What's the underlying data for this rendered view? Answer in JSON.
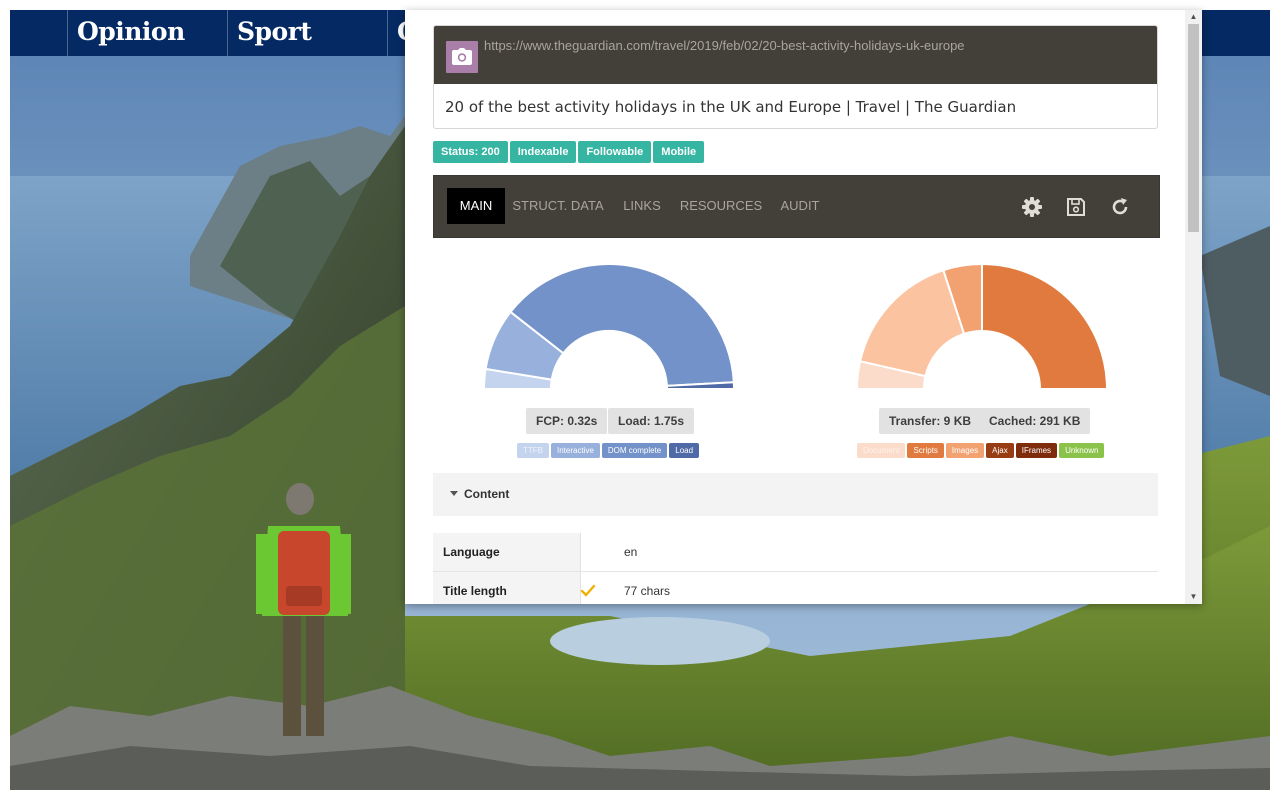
{
  "site_nav": {
    "items": [
      "Opinion",
      "Sport",
      "C"
    ]
  },
  "popup": {
    "url": "https://www.theguardian.com/travel/2019/feb/02/20-best-activity-holidays-uk-europe",
    "page_title": "20 of the best activity holidays in the UK and Europe | Travel | The Guardian",
    "badges": [
      "Status: 200",
      "Indexable",
      "Followable",
      "Mobile"
    ],
    "tabs": [
      {
        "label": "MAIN",
        "active": true
      },
      {
        "label": "STRUCT. DATA",
        "active": false
      },
      {
        "label": "LINKS",
        "active": false
      },
      {
        "label": "RESOURCES",
        "active": false
      },
      {
        "label": "AUDIT",
        "active": false
      }
    ],
    "tool_icons": [
      "gear-icon",
      "save-icon",
      "reload-icon"
    ],
    "perf": {
      "fcp_label": "FCP: 0.32s",
      "load_label": "Load: 1.75s",
      "legend": [
        {
          "label": "TTFB",
          "color": "#c4d3ee",
          "text_color": "#eef2fa"
        },
        {
          "label": "Interactive",
          "color": "#97b0dc",
          "text_color": "#ffffff"
        },
        {
          "label": "DOM complete",
          "color": "#7392c9",
          "text_color": "#ffffff"
        },
        {
          "label": "Load",
          "color": "#4f6aa6",
          "text_color": "#ffffff"
        }
      ]
    },
    "size": {
      "transfer_label": "Transfer: 9 KB",
      "cached_label": "Cached: 291 KB",
      "legend": [
        {
          "label": "Document",
          "color": "#fbdcca",
          "text_color": "#fdf1ea"
        },
        {
          "label": "Scripts",
          "color": "#e17a3e",
          "text_color": "#ffffff"
        },
        {
          "label": "Images",
          "color": "#f2a171",
          "text_color": "#ffffff"
        },
        {
          "label": "Ajax",
          "color": "#983c14",
          "text_color": "#ffffff"
        },
        {
          "label": "IFrames",
          "color": "#7f2c0c",
          "text_color": "#ffffff"
        },
        {
          "label": "Unknown",
          "color": "#8bc34a",
          "text_color": "#ffffff"
        }
      ]
    },
    "content_section_label": "Content",
    "content_rows": [
      {
        "label": "Language",
        "value": "en",
        "icon": ""
      },
      {
        "label": "Title length",
        "value": "77 chars",
        "icon": "check-icon"
      }
    ]
  },
  "chart_data": [
    {
      "type": "pie",
      "style": "half-donut",
      "title": "",
      "categories": [
        "TTFB",
        "Interactive",
        "DOM complete",
        "Load"
      ],
      "values": [
        0.09,
        0.28,
        1.35,
        0.03
      ],
      "colors": [
        "#c4d3ee",
        "#97b0dc",
        "#7392c9",
        "#4f6aa6"
      ],
      "legend_placement": "bottom"
    },
    {
      "type": "pie",
      "style": "half-donut",
      "title": "",
      "categories": [
        "Document",
        "Scripts",
        "Images",
        "Ajax",
        "IFrames",
        "Unknown"
      ],
      "values": [
        10,
        70,
        14,
        0,
        0,
        0
      ],
      "extra_slice": {
        "value": 46,
        "color": "#fbc3a0"
      },
      "colors": [
        "#fbdcca",
        "#e17a3e",
        "#f2a171",
        "#983c14",
        "#7f2c0c",
        "#8bc34a"
      ],
      "legend_placement": "bottom"
    }
  ]
}
